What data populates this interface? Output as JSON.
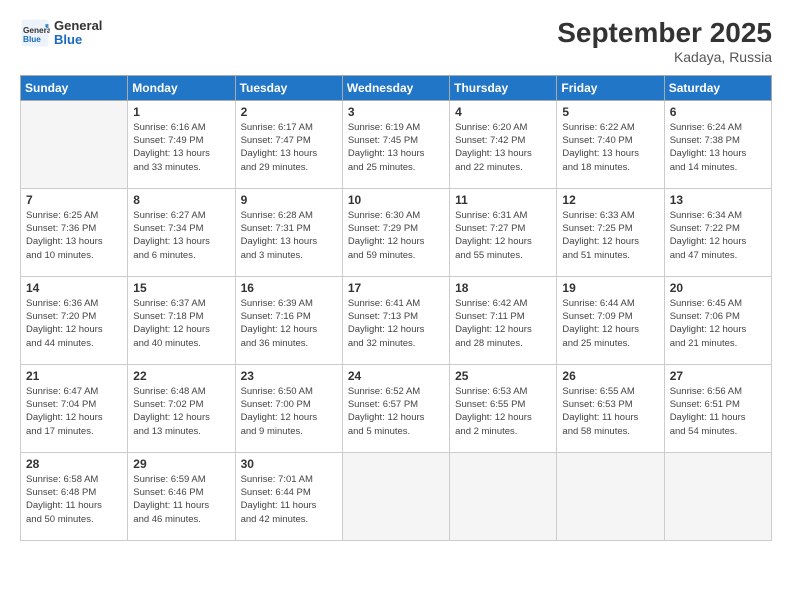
{
  "header": {
    "logo_general": "General",
    "logo_blue": "Blue",
    "month_title": "September 2025",
    "location": "Kadaya, Russia"
  },
  "weekdays": [
    "Sunday",
    "Monday",
    "Tuesday",
    "Wednesday",
    "Thursday",
    "Friday",
    "Saturday"
  ],
  "weeks": [
    [
      {
        "day": "",
        "info": ""
      },
      {
        "day": "1",
        "info": "Sunrise: 6:16 AM\nSunset: 7:49 PM\nDaylight: 13 hours\nand 33 minutes."
      },
      {
        "day": "2",
        "info": "Sunrise: 6:17 AM\nSunset: 7:47 PM\nDaylight: 13 hours\nand 29 minutes."
      },
      {
        "day": "3",
        "info": "Sunrise: 6:19 AM\nSunset: 7:45 PM\nDaylight: 13 hours\nand 25 minutes."
      },
      {
        "day": "4",
        "info": "Sunrise: 6:20 AM\nSunset: 7:42 PM\nDaylight: 13 hours\nand 22 minutes."
      },
      {
        "day": "5",
        "info": "Sunrise: 6:22 AM\nSunset: 7:40 PM\nDaylight: 13 hours\nand 18 minutes."
      },
      {
        "day": "6",
        "info": "Sunrise: 6:24 AM\nSunset: 7:38 PM\nDaylight: 13 hours\nand 14 minutes."
      }
    ],
    [
      {
        "day": "7",
        "info": "Sunrise: 6:25 AM\nSunset: 7:36 PM\nDaylight: 13 hours\nand 10 minutes."
      },
      {
        "day": "8",
        "info": "Sunrise: 6:27 AM\nSunset: 7:34 PM\nDaylight: 13 hours\nand 6 minutes."
      },
      {
        "day": "9",
        "info": "Sunrise: 6:28 AM\nSunset: 7:31 PM\nDaylight: 13 hours\nand 3 minutes."
      },
      {
        "day": "10",
        "info": "Sunrise: 6:30 AM\nSunset: 7:29 PM\nDaylight: 12 hours\nand 59 minutes."
      },
      {
        "day": "11",
        "info": "Sunrise: 6:31 AM\nSunset: 7:27 PM\nDaylight: 12 hours\nand 55 minutes."
      },
      {
        "day": "12",
        "info": "Sunrise: 6:33 AM\nSunset: 7:25 PM\nDaylight: 12 hours\nand 51 minutes."
      },
      {
        "day": "13",
        "info": "Sunrise: 6:34 AM\nSunset: 7:22 PM\nDaylight: 12 hours\nand 47 minutes."
      }
    ],
    [
      {
        "day": "14",
        "info": "Sunrise: 6:36 AM\nSunset: 7:20 PM\nDaylight: 12 hours\nand 44 minutes."
      },
      {
        "day": "15",
        "info": "Sunrise: 6:37 AM\nSunset: 7:18 PM\nDaylight: 12 hours\nand 40 minutes."
      },
      {
        "day": "16",
        "info": "Sunrise: 6:39 AM\nSunset: 7:16 PM\nDaylight: 12 hours\nand 36 minutes."
      },
      {
        "day": "17",
        "info": "Sunrise: 6:41 AM\nSunset: 7:13 PM\nDaylight: 12 hours\nand 32 minutes."
      },
      {
        "day": "18",
        "info": "Sunrise: 6:42 AM\nSunset: 7:11 PM\nDaylight: 12 hours\nand 28 minutes."
      },
      {
        "day": "19",
        "info": "Sunrise: 6:44 AM\nSunset: 7:09 PM\nDaylight: 12 hours\nand 25 minutes."
      },
      {
        "day": "20",
        "info": "Sunrise: 6:45 AM\nSunset: 7:06 PM\nDaylight: 12 hours\nand 21 minutes."
      }
    ],
    [
      {
        "day": "21",
        "info": "Sunrise: 6:47 AM\nSunset: 7:04 PM\nDaylight: 12 hours\nand 17 minutes."
      },
      {
        "day": "22",
        "info": "Sunrise: 6:48 AM\nSunset: 7:02 PM\nDaylight: 12 hours\nand 13 minutes."
      },
      {
        "day": "23",
        "info": "Sunrise: 6:50 AM\nSunset: 7:00 PM\nDaylight: 12 hours\nand 9 minutes."
      },
      {
        "day": "24",
        "info": "Sunrise: 6:52 AM\nSunset: 6:57 PM\nDaylight: 12 hours\nand 5 minutes."
      },
      {
        "day": "25",
        "info": "Sunrise: 6:53 AM\nSunset: 6:55 PM\nDaylight: 12 hours\nand 2 minutes."
      },
      {
        "day": "26",
        "info": "Sunrise: 6:55 AM\nSunset: 6:53 PM\nDaylight: 11 hours\nand 58 minutes."
      },
      {
        "day": "27",
        "info": "Sunrise: 6:56 AM\nSunset: 6:51 PM\nDaylight: 11 hours\nand 54 minutes."
      }
    ],
    [
      {
        "day": "28",
        "info": "Sunrise: 6:58 AM\nSunset: 6:48 PM\nDaylight: 11 hours\nand 50 minutes."
      },
      {
        "day": "29",
        "info": "Sunrise: 6:59 AM\nSunset: 6:46 PM\nDaylight: 11 hours\nand 46 minutes."
      },
      {
        "day": "30",
        "info": "Sunrise: 7:01 AM\nSunset: 6:44 PM\nDaylight: 11 hours\nand 42 minutes."
      },
      {
        "day": "",
        "info": ""
      },
      {
        "day": "",
        "info": ""
      },
      {
        "day": "",
        "info": ""
      },
      {
        "day": "",
        "info": ""
      }
    ]
  ]
}
